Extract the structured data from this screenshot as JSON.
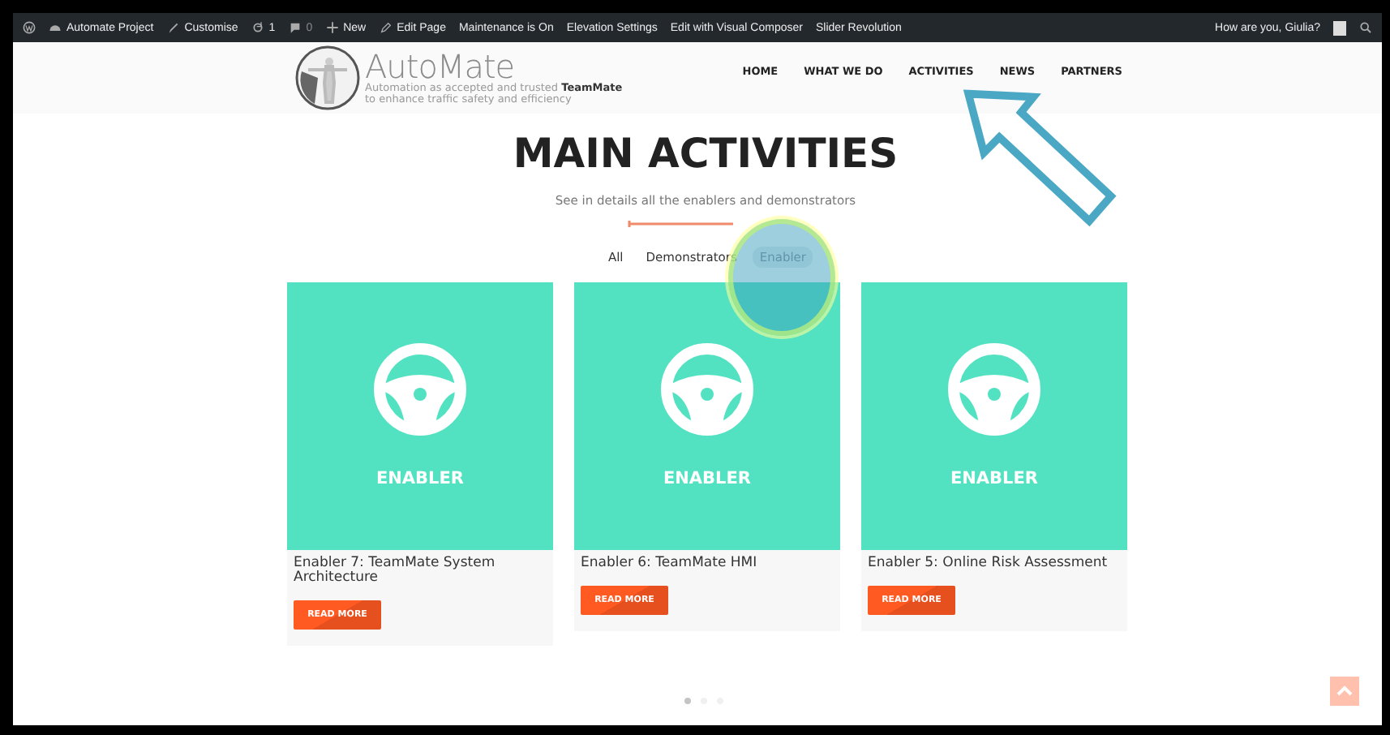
{
  "admin_bar": {
    "left": [
      {
        "kind": "wp"
      },
      {
        "kind": "site",
        "text": "Automate Project"
      },
      {
        "kind": "brush",
        "text": "Customise"
      },
      {
        "kind": "updates",
        "text": "1"
      },
      {
        "kind": "comments",
        "text": "0"
      },
      {
        "kind": "plus",
        "text": "New"
      },
      {
        "kind": "pencil",
        "text": "Edit Page"
      },
      {
        "kind": "plain",
        "text": "Maintenance is On"
      },
      {
        "kind": "plain",
        "text": "Elevation Settings"
      },
      {
        "kind": "plain",
        "text": "Edit with Visual Composer"
      },
      {
        "kind": "plain",
        "text": "Slider Revolution"
      }
    ],
    "greeting": "How are you, Giulia?"
  },
  "header": {
    "logo_title": "AutoMate",
    "logo_tagline": [
      "Automation as accepted and trusted **TeamMate**",
      "to enhance traffic safety and efficiency"
    ],
    "nav": [
      {
        "label": "HOME"
      },
      {
        "label": "WHAT WE DO"
      },
      {
        "label": "ACTIVITIES"
      },
      {
        "label": "NEWS"
      },
      {
        "label": "PARTNERS"
      }
    ]
  },
  "heading": "MAIN ACTIVITIES",
  "subtitle": "See in details all the enablers and demonstrators",
  "filters": [
    {
      "label": "All",
      "selected": false
    },
    {
      "label": "Demonstrators",
      "selected": false
    },
    {
      "label": "Enabler",
      "selected": true
    }
  ],
  "cards": [
    {
      "category": "ENABLER",
      "title": "Enabler 7: TeamMate System Architecture",
      "button": "READ MORE"
    },
    {
      "category": "ENABLER",
      "title": "Enabler 6: TeamMate HMI",
      "button": "READ MORE"
    },
    {
      "category": "ENABLER",
      "title": "Enabler 5: Online Risk Assessment",
      "button": "READ MORE"
    }
  ],
  "pager": [
    {
      "selected": true
    },
    {
      "selected": false
    },
    {
      "selected": false
    }
  ]
}
